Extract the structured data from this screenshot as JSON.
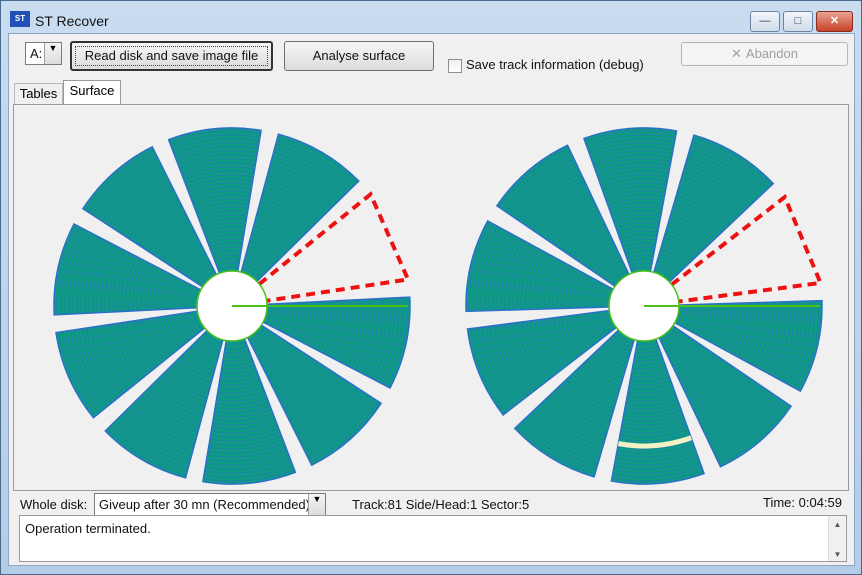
{
  "window": {
    "title": "ST Recover",
    "app_icon_text": "ST",
    "minimize_label": "—",
    "maximize_label": "□",
    "close_label": "✕"
  },
  "toolbar": {
    "drive_value": "A:",
    "read_button_label": "Read disk and save image file",
    "analyse_button_label": "Analyse surface",
    "save_track_label": "Save track information (debug)",
    "save_track_checked": false,
    "abandon_label": "Abandon",
    "abandon_icon": "✕"
  },
  "tabs": [
    {
      "label": "Tables",
      "active": false
    },
    {
      "label": "Surface",
      "active": true
    }
  ],
  "surface": {
    "colors": {
      "track_fill": "#0f9a84",
      "track_line": "#2a6fc9",
      "marker_line": "#4cc01a",
      "selection": "#ee1111"
    },
    "disks": [
      {
        "name": "side-0-disk",
        "sector_count": 10,
        "current_sector_highlighted": true
      },
      {
        "name": "side-1-disk",
        "sector_count": 10,
        "current_sector_highlighted": true
      }
    ]
  },
  "status": {
    "whole_disk_label": "Whole disk:",
    "giveup_value": "Giveup after 30 mn (Recommended)",
    "track_info": "Track:81 Side/Head:1 Sector:5",
    "time": "Time: 0:04:59"
  },
  "log": {
    "text": "Operation terminated."
  }
}
